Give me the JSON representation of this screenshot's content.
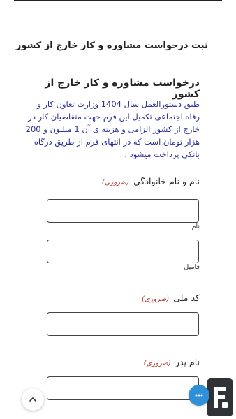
{
  "header": {
    "page_title": "ثبت درخواست مشاوره و کار خارج از کشور"
  },
  "form": {
    "title": "درخواست مشاوره و کار خارج از کشور",
    "intro": "طبق دستورالعمل سال 1404 وزارت تعاون کار و رفاه اجتماعی تکمیل این فرم جهت متقاضیان کار در خارج از کشور الزامی و هزینه ی آن 1 میلیون و 200 هزار تومان است که در انتهای فرم از طریق درگاه بانکی پرداخت میشود .",
    "fields": [
      {
        "label": "نام و نام خانوادگی",
        "required": "(ضروری)",
        "sublabels": [
          "نام",
          "فامیل"
        ]
      },
      {
        "label": "کد ملی",
        "required": "(ضروری)"
      },
      {
        "label": "نام پدر",
        "required": "(ضروری)"
      }
    ]
  },
  "widgets": {
    "scroll_top_icon": "chevron-up-icon",
    "chat_icon": "chat-bubble-icon",
    "chat_color": "#2f8fd8",
    "brand_logo_icon": "phone-brand-logo"
  }
}
